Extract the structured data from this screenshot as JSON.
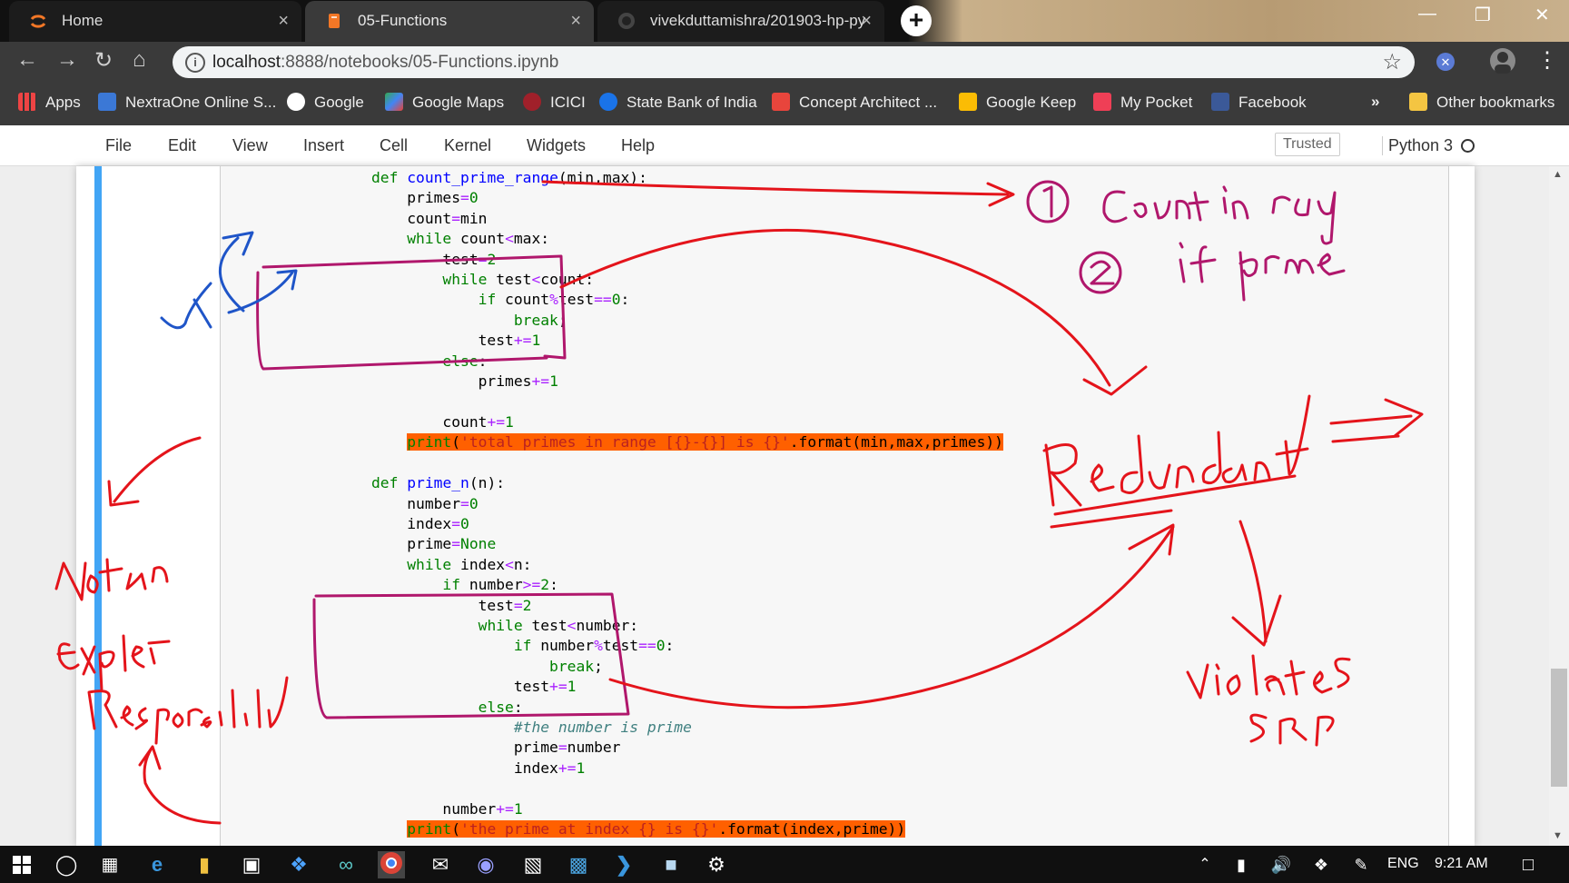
{
  "browser": {
    "tabs": [
      {
        "label": "Home",
        "close": "×"
      },
      {
        "label": "05-Functions",
        "close": "×"
      },
      {
        "label": "vivekduttamishra/201903-hp-py",
        "close": "×"
      }
    ],
    "new_tab": "+",
    "url_host": "localhost",
    "url_rest": ":8888/notebooks/05-Functions.ipynb",
    "bookmarks": [
      "Apps",
      "NextraOne Online S...",
      "Google",
      "Google Maps",
      "ICICI",
      "State Bank of India",
      "Concept Architect ...",
      "Google Keep",
      "My Pocket",
      "Facebook"
    ],
    "bookmarks_more": "»",
    "other_bookmarks": "Other bookmarks"
  },
  "jupyter": {
    "menu": [
      "File",
      "Edit",
      "View",
      "Insert",
      "Cell",
      "Kernel",
      "Widgets",
      "Help"
    ],
    "trusted": "Trusted",
    "kernel": "Python 3"
  },
  "code_lines": [
    "def count_prime_range(min,max):",
    "    primes=0",
    "    count=min",
    "    while count<max:",
    "        test=2",
    "        while test<count:",
    "            if count%test==0:",
    "                break;",
    "            test+=1",
    "        else:",
    "            primes+=1",
    "",
    "        count+=1",
    "    print('total primes in range [{}-{}] is {}'.format(min,max,primes))",
    "",
    "def prime_n(n):",
    "    number=0",
    "    index=0",
    "    prime=None",
    "    while index<n:",
    "        if number>=2:",
    "            test=2",
    "            while test<number:",
    "                if number%test==0:",
    "                    break;",
    "                test+=1",
    "            else:",
    "                #the number is prime",
    "                prime=number",
    "                index+=1",
    "",
    "        number+=1",
    "    print('the prime at index {} is {}'.format(index,prime))"
  ],
  "annotations": {
    "colors": {
      "red": "#e4141b",
      "magenta": "#b0176c",
      "blue": "#1f55c8",
      "highlight": "#ff6000"
    }
  },
  "taskbar": {
    "lang": "ENG",
    "time": "9:21 AM"
  }
}
